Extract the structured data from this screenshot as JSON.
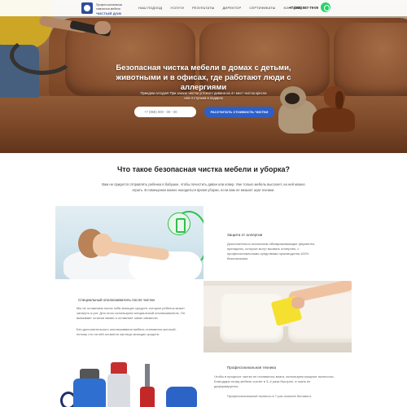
{
  "header": {
    "logo_line1": "Профессиональная химчистка мебели",
    "logo_brand": "ЧИСТЫЙ ДОМ",
    "nav": [
      "НАШ ПОДХОД",
      "УСЛУГИ",
      "РЕЗУЛЬТАТЫ",
      "ДИРЕКТОР",
      "СЕРТИФИКАТЫ",
      "КОНТАКТЫ"
    ],
    "phone": "+7 (968) 567-79-09",
    "whatsapp_icon": "whatsapp-icon"
  },
  "hero": {
    "title": "Безопасная чистка мебели в домах с детьми, животными и в офисах, где работают люди с аллергиями",
    "subtitle": "Приедем сегодня! При заказе чистки углового дивана на 4+ мест чистка кресла или 4 стульев в подарок",
    "phone_placeholder": "+7 (968) 000 - 00 - 00",
    "cta_label": "РАССЧИТАТЬ СТОИМОСТЬ ЧИСТКИ"
  },
  "section": {
    "title": "Что такое безопасная чистка мебели и уборка?",
    "text": "Вам не придется отправлять ребенка в бабушке, чтобы почистить диван или ковер. Уже только мебель высохнет, на ней можно играть. В помещении можно находиться время уборки, если вам не мешает шум техники."
  },
  "features": [
    {
      "title": "Защита от аллергии",
      "text": "Дополнительно исключаем обезвреживающие ферменты, препараты, которые могут вызвать аллергию, с профессиональными средствами производства 100% безопасными."
    },
    {
      "title": "Специальный ополаскиватель после чистки",
      "text": "Мы не оставляем после себя моющих средств, которые ребенок может затянуть в рот. Для этого используем специальный ополаскиватель. Он вымывает остатки химии и оставляет запах свежести.",
      "extra": "Без дополнительного ополаскивания мебель становится жесткой, потому что на ней остаются частицы моющих средств."
    },
    {
      "title": "Профессиональная техника",
      "text": "Чтобы в процессе чистки не оставалось влаги, используем мощные пылесосы. Благодаря этому мебель сохнет в 3–4 раза быстрее, а ткань не деформируется.",
      "extra": "Профессиональный пылесос в 7 раз сильнее бытового."
    }
  ],
  "icons": {
    "allergy_icon": "shield-icon"
  },
  "colors": {
    "accent_blue": "#2d5fc9",
    "green": "#2ebf4f",
    "sofa_brown": "#9a5a32"
  }
}
